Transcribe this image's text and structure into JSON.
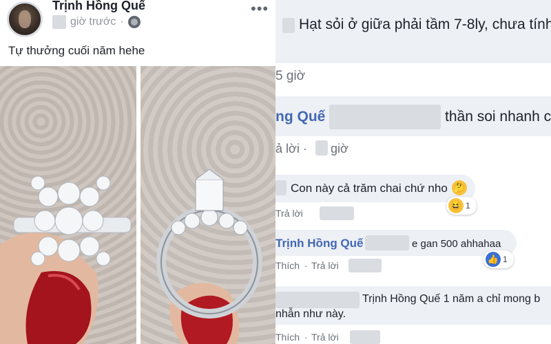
{
  "post": {
    "author": "Trịnh Hồng Quế",
    "time_suffix": "giờ trước",
    "separator": "·",
    "more": "•••",
    "caption": "Tự thưởng cuối năm hehe"
  },
  "comments": {
    "c1_text": "Hạt sỏi ở giữa phải tầm 7-8ly, chưa tính",
    "c1_time": "5 giờ",
    "c2_name": "ng Quế",
    "c2_text": "thần soi nhanh c",
    "c2_reply": "ả lời ·",
    "c2_time": "giờ",
    "c3_text": "Con này cả trăm chai chứ nho",
    "c3_reply": "Trả lời",
    "c3_reaction_count": "1",
    "c4_name": "Trịnh Hồng Quế",
    "c4_text": "e gan 500 ahhahaa",
    "c4_like": "Thích",
    "c4_dot": "·",
    "c4_reply": "Trả lời",
    "c4_reaction_count": "1",
    "c5_text_1": "Trịnh Hồng Quế 1 năm a chỉ mong b",
    "c5_text_2": "nhẫn như này.",
    "c5_like": "Thích",
    "c5_dot": "·",
    "c5_reply": "Trả lời"
  },
  "colors": {
    "link": "#4267b2",
    "bubble": "#edf0f5",
    "meta": "#90949c"
  }
}
